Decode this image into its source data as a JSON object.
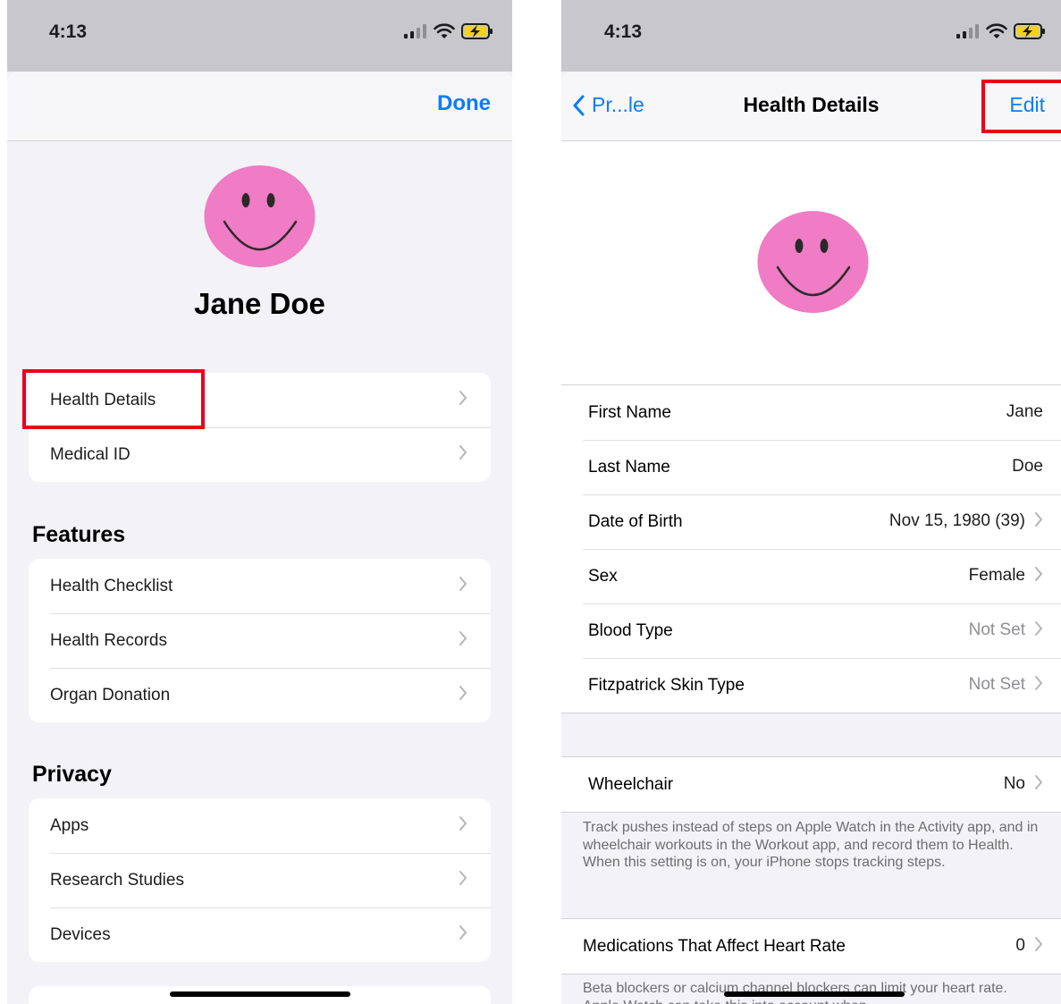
{
  "left_screen": {
    "status": {
      "time": "4:13"
    },
    "done_label": "Done",
    "profile_name": "Jane Doe",
    "account_items": [
      {
        "label": "Health Details"
      },
      {
        "label": "Medical ID"
      }
    ],
    "features": {
      "title": "Features",
      "items": [
        {
          "label": "Health Checklist"
        },
        {
          "label": "Health Records"
        },
        {
          "label": "Organ Donation"
        }
      ]
    },
    "privacy": {
      "title": "Privacy",
      "items": [
        {
          "label": "Apps"
        },
        {
          "label": "Research Studies"
        },
        {
          "label": "Devices"
        }
      ]
    }
  },
  "right_screen": {
    "status": {
      "time": "4:13"
    },
    "nav": {
      "back_label": "Pr...le",
      "title": "Health Details",
      "edit_label": "Edit"
    },
    "details": [
      {
        "label": "First Name",
        "value": "Jane"
      },
      {
        "label": "Last Name",
        "value": "Doe"
      },
      {
        "label": "Date of Birth",
        "value": "Nov 15, 1980 (39)"
      },
      {
        "label": "Sex",
        "value": "Female"
      },
      {
        "label": "Blood Type",
        "value": "Not Set"
      },
      {
        "label": "Fitzpatrick Skin Type",
        "value": "Not Set"
      }
    ],
    "wheelchair": {
      "label": "Wheelchair",
      "value": "No",
      "footnote": "Track pushes instead of steps on Apple Watch in the Activity app, and in wheelchair workouts in the Workout app, and record them to Health. When this setting is on, your iPhone stops tracking steps."
    },
    "medications": {
      "label": "Medications That Affect Heart Rate",
      "value": "0",
      "footnote": "Beta blockers or calcium channel blockers can limit your heart rate. Apple Watch can take this into account when"
    }
  },
  "colors": {
    "accent": "#0a7cff",
    "highlight": "#e8001c",
    "avatar": "#ef7cc4"
  }
}
